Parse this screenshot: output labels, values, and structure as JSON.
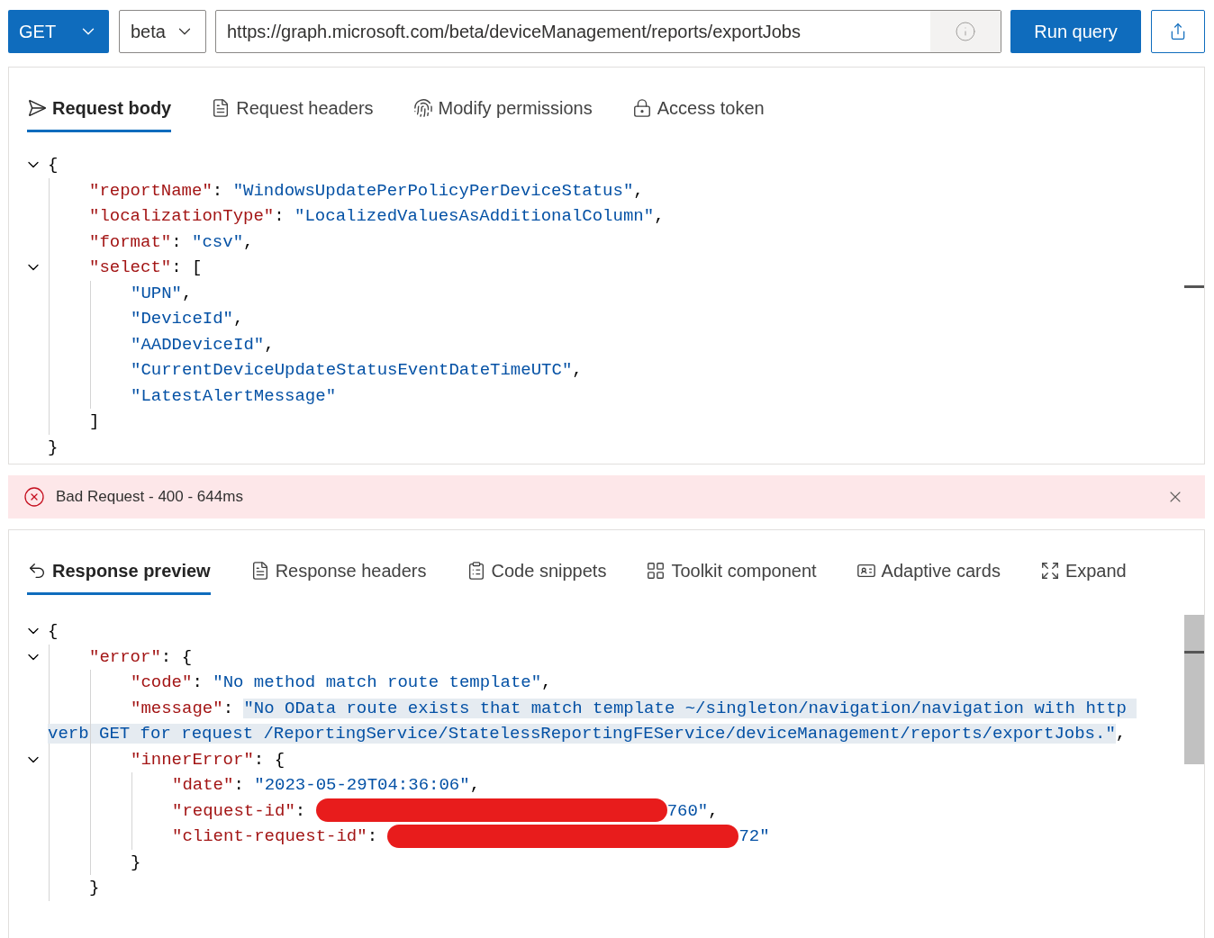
{
  "toolbar": {
    "method": "GET",
    "version": "beta",
    "url": "https://graph.microsoft.com/beta/deviceManagement/reports/exportJobs",
    "run_button": "Run query"
  },
  "request_tabs": [
    {
      "label": "Request body",
      "selected": true
    },
    {
      "label": "Request headers",
      "selected": false
    },
    {
      "label": "Modify permissions",
      "selected": false
    },
    {
      "label": "Access token",
      "selected": false
    }
  ],
  "request_body": {
    "tokens": [
      {
        "kind": "punct",
        "text": "{"
      }
    ],
    "expanded": true,
    "close": [
      {
        "kind": "punct",
        "text": "}"
      }
    ],
    "children": [
      {
        "tokens": [
          {
            "kind": "key",
            "text": "\"reportName\""
          },
          {
            "kind": "punct",
            "text": ": "
          },
          {
            "kind": "string",
            "text": "\"WindowsUpdatePerPolicyPerDeviceStatus\""
          },
          {
            "kind": "punct",
            "text": ","
          }
        ]
      },
      {
        "tokens": [
          {
            "kind": "key",
            "text": "\"localizationType\""
          },
          {
            "kind": "punct",
            "text": ": "
          },
          {
            "kind": "string",
            "text": "\"LocalizedValuesAsAdditionalColumn\""
          },
          {
            "kind": "punct",
            "text": ","
          }
        ]
      },
      {
        "tokens": [
          {
            "kind": "key",
            "text": "\"format\""
          },
          {
            "kind": "punct",
            "text": ": "
          },
          {
            "kind": "string",
            "text": "\"csv\""
          },
          {
            "kind": "punct",
            "text": ","
          }
        ]
      },
      {
        "tokens": [
          {
            "kind": "key",
            "text": "\"select\""
          },
          {
            "kind": "punct",
            "text": ": ["
          }
        ],
        "expanded": true,
        "close": [
          {
            "kind": "punct",
            "text": "]"
          }
        ],
        "children": [
          {
            "tokens": [
              {
                "kind": "string",
                "text": "\"UPN\""
              },
              {
                "kind": "punct",
                "text": ","
              }
            ]
          },
          {
            "tokens": [
              {
                "kind": "string",
                "text": "\"DeviceId\""
              },
              {
                "kind": "punct",
                "text": ","
              }
            ]
          },
          {
            "tokens": [
              {
                "kind": "string",
                "text": "\"AADDeviceId\""
              },
              {
                "kind": "punct",
                "text": ","
              }
            ]
          },
          {
            "tokens": [
              {
                "kind": "string",
                "text": "\"CurrentDeviceUpdateStatusEventDateTimeUTC\""
              },
              {
                "kind": "punct",
                "text": ","
              }
            ]
          },
          {
            "tokens": [
              {
                "kind": "string",
                "text": "\"LatestAlertMessage\""
              }
            ]
          }
        ]
      }
    ]
  },
  "status": {
    "kind": "error",
    "text": "Bad Request - 400 - 644ms"
  },
  "response_tabs": [
    {
      "label": "Response preview",
      "selected": true
    },
    {
      "label": "Response headers",
      "selected": false
    },
    {
      "label": "Code snippets",
      "selected": false
    },
    {
      "label": "Toolkit component",
      "selected": false
    },
    {
      "label": "Adaptive cards",
      "selected": false
    },
    {
      "label": "Expand",
      "selected": false
    }
  ],
  "response_body": {
    "tokens": [
      {
        "kind": "punct",
        "text": "{"
      }
    ],
    "expanded": true,
    "children": [
      {
        "tokens": [
          {
            "kind": "key",
            "text": "\"error\""
          },
          {
            "kind": "punct",
            "text": ": {"
          }
        ],
        "expanded": true,
        "close": [
          {
            "kind": "punct",
            "text": "}"
          }
        ],
        "children": [
          {
            "tokens": [
              {
                "kind": "key",
                "text": "\"code\""
              },
              {
                "kind": "punct",
                "text": ": "
              },
              {
                "kind": "string",
                "text": "\"No method match route template\""
              },
              {
                "kind": "punct",
                "text": ","
              }
            ]
          },
          {
            "tokens": [
              {
                "kind": "key",
                "text": "\"message\""
              },
              {
                "kind": "punct",
                "text": ": "
              },
              {
                "kind": "selection",
                "text": "\"No OData route exists that match template ~/singleton/navigation/navigation with http verb GET for request /ReportingService/StatelessReportingFEService/deviceManagement/reports/exportJobs.\""
              },
              {
                "kind": "punct",
                "text": ","
              }
            ]
          },
          {
            "tokens": [
              {
                "kind": "key",
                "text": "\"innerError\""
              },
              {
                "kind": "punct",
                "text": ": {"
              }
            ],
            "expanded": true,
            "close": [
              {
                "kind": "punct",
                "text": "}"
              }
            ],
            "children": [
              {
                "tokens": [
                  {
                    "kind": "key",
                    "text": "\"date\""
                  },
                  {
                    "kind": "punct",
                    "text": ": "
                  },
                  {
                    "kind": "string",
                    "text": "\"2023-05-29T04:36:06\""
                  },
                  {
                    "kind": "punct",
                    "text": ","
                  }
                ]
              },
              {
                "tokens": [
                  {
                    "kind": "key",
                    "text": "\"request-id\""
                  },
                  {
                    "kind": "punct",
                    "text": ": "
                  },
                  {
                    "kind": "redacted"
                  },
                  {
                    "kind": "string",
                    "text": "760\""
                  },
                  {
                    "kind": "punct",
                    "text": ","
                  }
                ]
              },
              {
                "tokens": [
                  {
                    "kind": "key",
                    "text": "\"client-request-id\""
                  },
                  {
                    "kind": "punct",
                    "text": ": "
                  },
                  {
                    "kind": "redacted"
                  },
                  {
                    "kind": "string",
                    "text": "72\""
                  }
                ]
              }
            ]
          }
        ]
      }
    ]
  }
}
